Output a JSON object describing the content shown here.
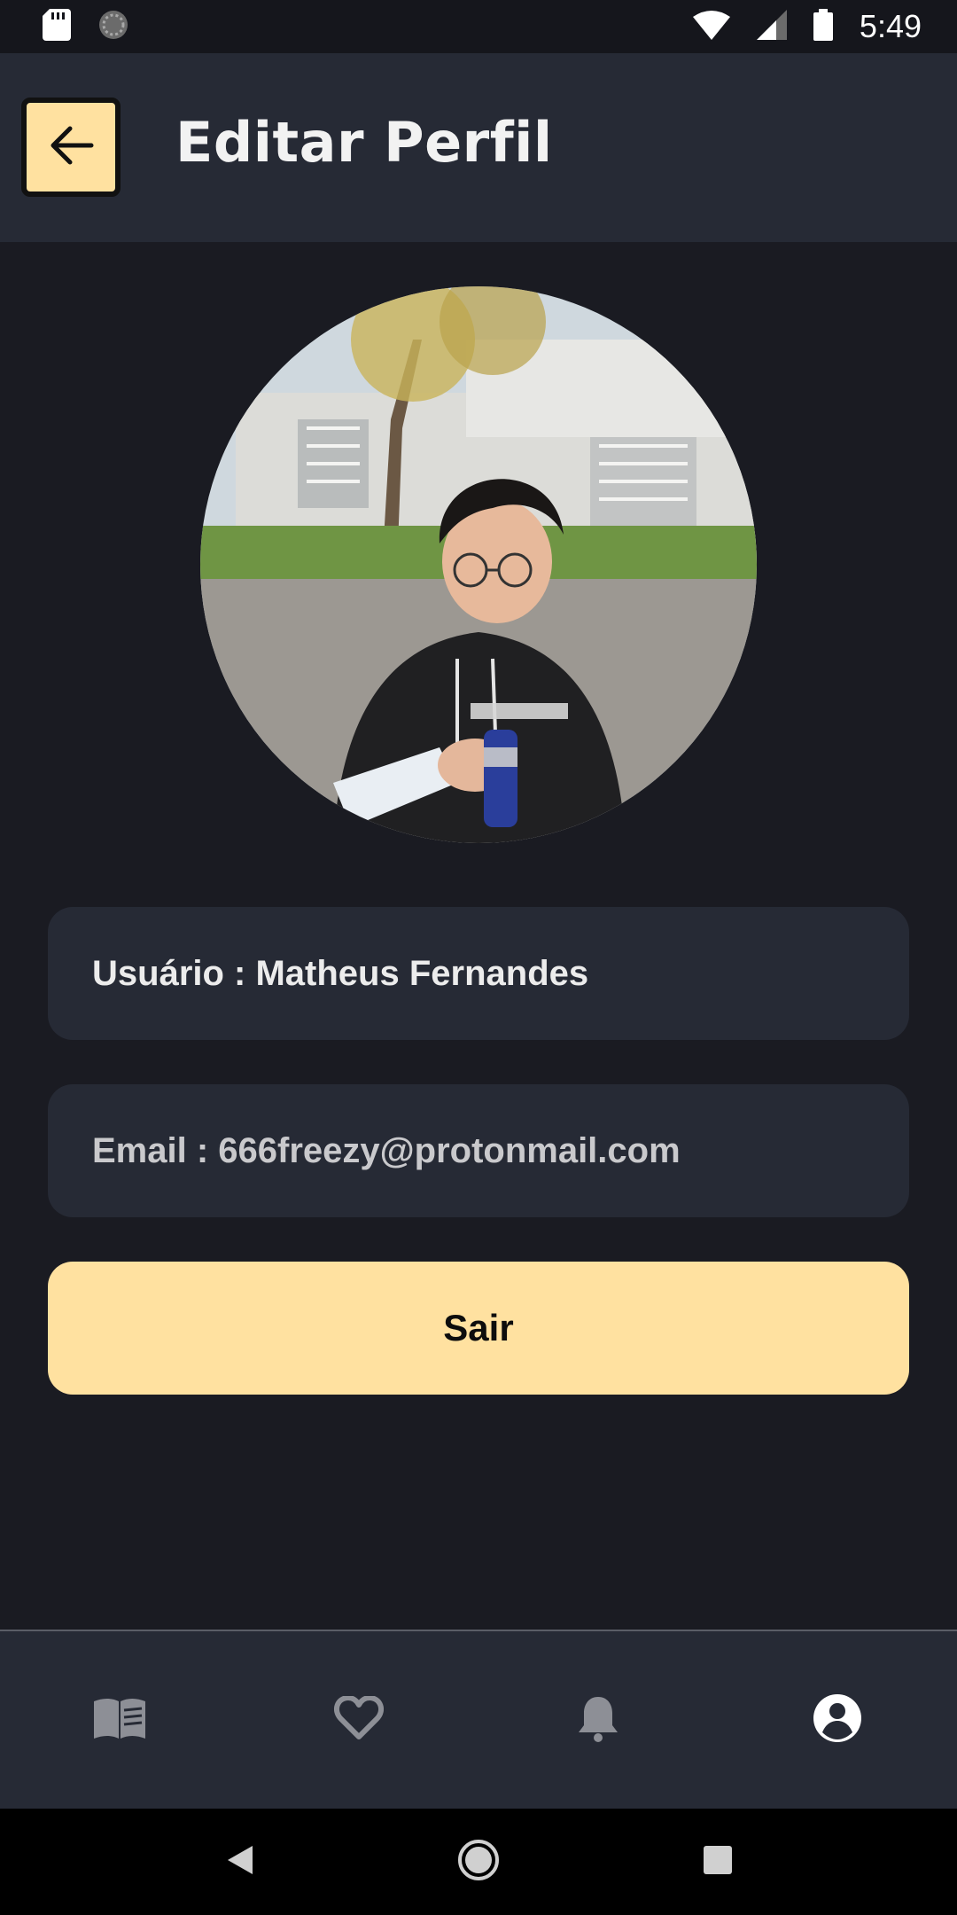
{
  "status_bar": {
    "time": "5:49",
    "icons": [
      "sd-card-icon",
      "sync-icon",
      "wifi-icon",
      "signal-icon",
      "battery-icon"
    ]
  },
  "header": {
    "title": "Editar Perfil",
    "back_icon": "arrow-left-icon"
  },
  "profile": {
    "user_field": "Usuário : Matheus Fernandes",
    "email_field": "Email : 666freezy@protonmail.com",
    "logout_label": "Sair"
  },
  "bottom_nav": {
    "items": [
      {
        "icon": "book-icon",
        "active": false
      },
      {
        "icon": "heart-icon",
        "active": false
      },
      {
        "icon": "bell-icon",
        "active": false
      },
      {
        "icon": "account-circle-icon",
        "active": true
      }
    ]
  },
  "colors": {
    "background": "#1a1b22",
    "surface": "#262a35",
    "accent": "#ffe1a0",
    "nav_inactive": "#8d8f96",
    "nav_active": "#ffffff"
  }
}
